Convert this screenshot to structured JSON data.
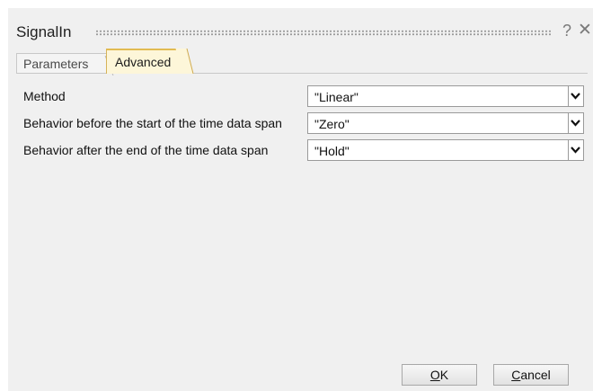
{
  "dialog": {
    "title": "SignalIn",
    "help_glyph": "?",
    "close_glyph": "✕"
  },
  "tabs": [
    {
      "label": "Parameters",
      "active": false
    },
    {
      "label": "Advanced",
      "active": true
    }
  ],
  "fields": [
    {
      "label": "Method",
      "value": "\"Linear\""
    },
    {
      "label": "Behavior before the start of the time data span",
      "value": "\"Zero\""
    },
    {
      "label": "Behavior after the end of the time data span",
      "value": "\"Hold\""
    }
  ],
  "buttons": {
    "ok_mnemonic": "O",
    "ok_rest": "K",
    "cancel_mnemonic": "C",
    "cancel_rest": "ancel"
  },
  "icons": {
    "help": "question-mark-icon",
    "close": "close-icon",
    "dropdown": "chevron-down-icon"
  },
  "colors": {
    "active_tab_fill": "#fdf6d9",
    "active_tab_accent": "#e2bb52",
    "dialog_background": "#f0f0f0"
  }
}
